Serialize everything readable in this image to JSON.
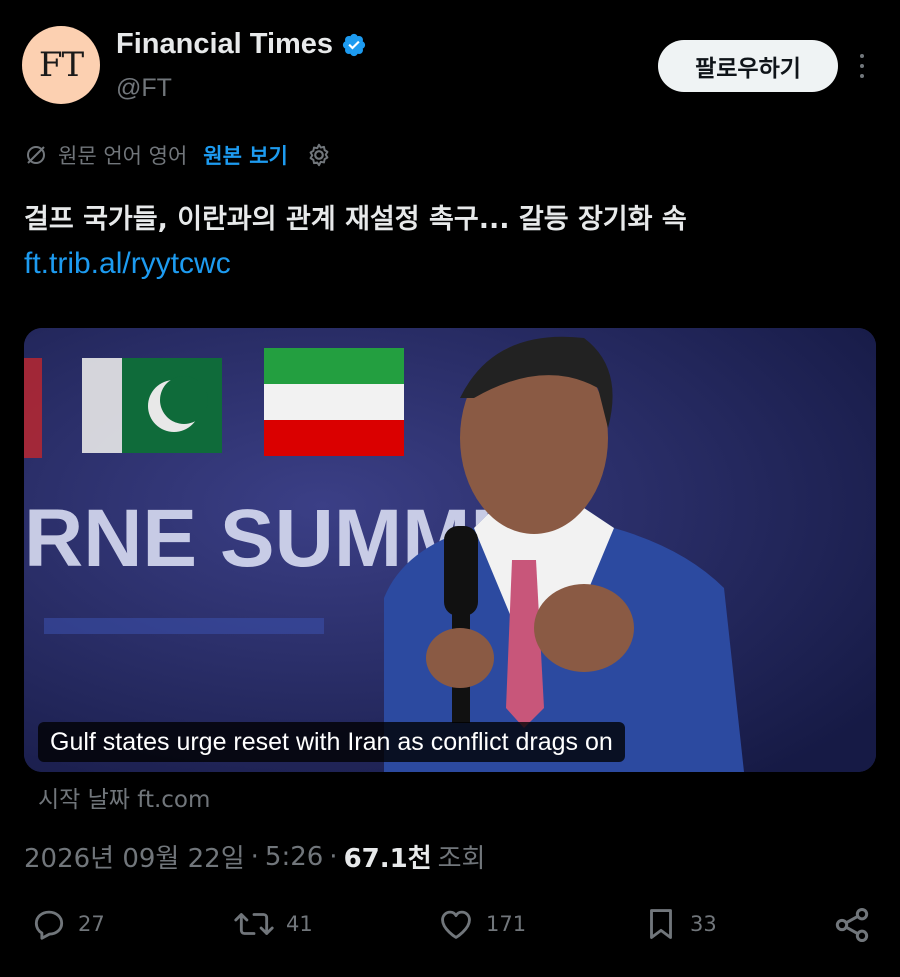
{
  "account": {
    "avatar_text": "FT",
    "display_name": "Financial Times",
    "handle": "@FT",
    "follow_label": "팔로우하기"
  },
  "translation": {
    "label": "원문 언어 영어",
    "link": "원본 보기"
  },
  "tweet": {
    "text": "걸프 국가들, 이란과의 관계 재설정 촉구... 갈등 장기화 속",
    "link": "ft.trib.al/ryytcwc"
  },
  "card": {
    "caption": "Gulf states urge reset with Iran as conflict drags on",
    "source": "시작 날짜 ft.com",
    "image_text": "RNE SUMMIT"
  },
  "meta": {
    "date": "2026년 09월 22일",
    "time": "5:26",
    "views": "67.1천",
    "views_label": "조회"
  },
  "actions": {
    "replies": "27",
    "reposts": "41",
    "likes": "171",
    "bookmarks": "33"
  },
  "colors": {
    "background": "#000000",
    "accent": "#1d9bf0",
    "muted": "#71767b",
    "avatar_bg": "#fcd0b1"
  }
}
